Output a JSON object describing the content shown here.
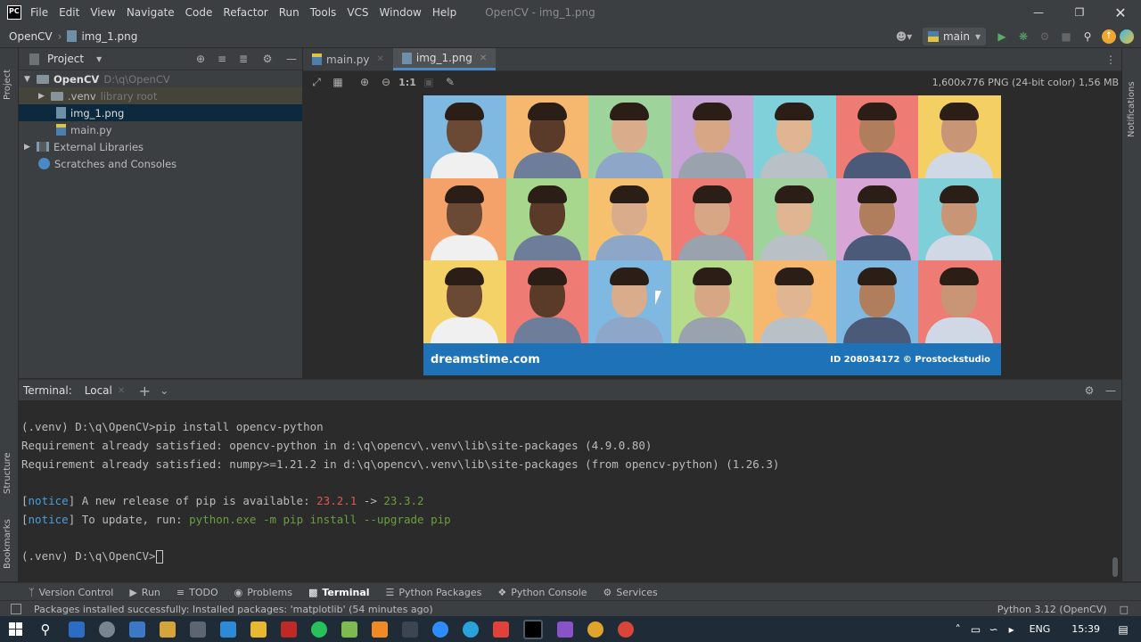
{
  "window": {
    "title": "OpenCV - img_1.png",
    "menu": [
      "File",
      "Edit",
      "View",
      "Navigate",
      "Code",
      "Refactor",
      "Run",
      "Tools",
      "VCS",
      "Window",
      "Help"
    ],
    "app_logo": "PC"
  },
  "navbar": {
    "project": "OpenCV",
    "file": "img_1.png",
    "run_config": "main"
  },
  "project_panel": {
    "title": "Project",
    "tree": [
      {
        "label": "OpenCV",
        "extra": "D:\\q\\OpenCV",
        "icon": "folder-icon"
      },
      {
        "label": ".venv",
        "extra": "library root",
        "icon": "folder-icon"
      },
      {
        "label": "img_1.png",
        "extra": "",
        "icon": "image-file-icon"
      },
      {
        "label": "main.py",
        "extra": "",
        "icon": "python-file-icon"
      },
      {
        "label": "External Libraries",
        "extra": "",
        "icon": "library-icon"
      },
      {
        "label": "Scratches and Consoles",
        "extra": "",
        "icon": "scratches-icon"
      }
    ]
  },
  "tabs": [
    {
      "label": "main.py"
    },
    {
      "label": "img_1.png"
    }
  ],
  "image_viewer": {
    "zoom_label": "1:1",
    "info": "1,600x776 PNG (24-bit color) 1,56 MB",
    "banner_left": "dreamstime.com",
    "banner_right": "ID 208034172 © Prostockstudio"
  },
  "terminal": {
    "label": "Terminal:",
    "tab": "Local",
    "lines": {
      "l1": "(.venv) D:\\q\\OpenCV>pip install opencv-python",
      "l2": "Requirement already satisfied: opencv-python in d:\\q\\opencv\\.venv\\lib\\site-packages (4.9.0.80)",
      "l3": "Requirement already satisfied: numpy>=1.21.2 in d:\\q\\opencv\\.venv\\lib\\site-packages (from opencv-python) (1.26.3)",
      "n1_bracket_open": "[",
      "n1_notice": "notice",
      "n1_mid": "] A new release of pip is available: ",
      "n1_old": "23.2.1",
      "n1_arrow": " -> ",
      "n1_new": "23.3.2",
      "n2_bracket_open": "[",
      "n2_notice": "notice",
      "n2_mid": "] To update, run: ",
      "n2_cmd": "python.exe -m pip install --upgrade pip",
      "prompt": "(.venv) D:\\q\\OpenCV>"
    }
  },
  "bottom_tools": [
    "Version Control",
    "Run",
    "TODO",
    "Problems",
    "Terminal",
    "Python Packages",
    "Python Console",
    "Services"
  ],
  "side_labels": {
    "project": "Project",
    "structure": "Structure",
    "bookmarks": "Bookmarks",
    "notifications": "Notifications"
  },
  "status": {
    "message": "Packages installed successfully: Installed packages: 'matplotlib' (54 minutes ago)",
    "interpreter": "Python 3.12 (OpenCV)"
  },
  "taskbar": {
    "language": "ENG",
    "time": "15:39"
  }
}
